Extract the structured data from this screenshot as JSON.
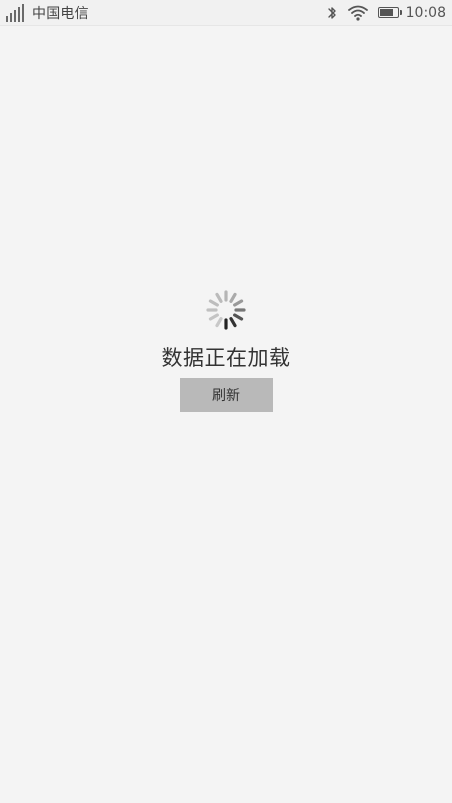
{
  "status_bar": {
    "carrier": "中国电信",
    "time": "10:08",
    "battery_level": 0.8,
    "signal_bars": 5,
    "icons": [
      "signal-icon",
      "bluetooth-icon",
      "wifi-icon",
      "battery-icon"
    ]
  },
  "loading": {
    "message": "数据正在加载",
    "refresh_label": "刷新"
  },
  "colors": {
    "background": "#f4f4f4",
    "button": "#b9b9b9",
    "text": "#333333"
  }
}
